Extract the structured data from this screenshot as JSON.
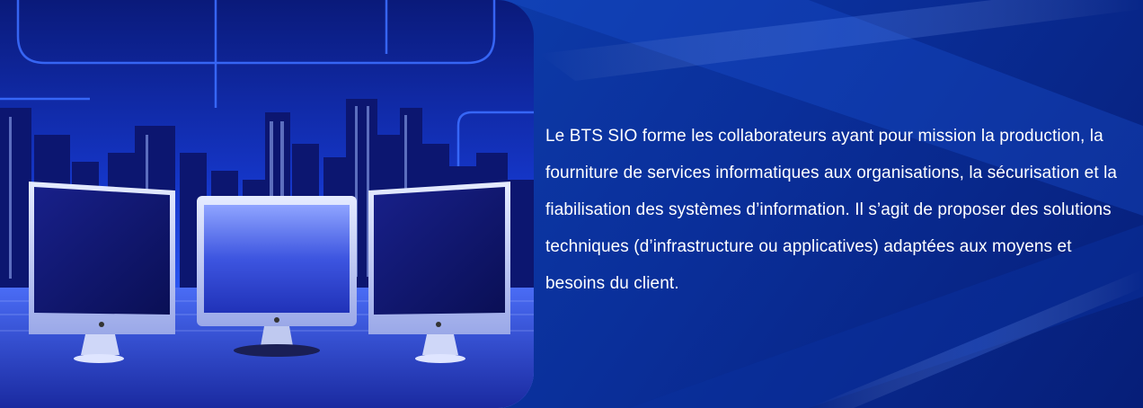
{
  "banner": {
    "illustration": {
      "icon": "city-monitors-illustration-icon",
      "monitor_count": 3
    },
    "description": "Le BTS SIO forme les collaborateurs ayant pour mission la production, la fourniture de services informatiques aux organisations, la sécurisation et la fiabilisation des systèmes d’information. Il s’agit de proposer des solutions techniques (d’infrastructure ou applicatives) adaptées aux moyens et besoins du client."
  },
  "colors": {
    "background_dark": "#061e78",
    "background_mid": "#0d3aa8",
    "neon_line": "#3b6dff",
    "text": "#ffffff"
  }
}
